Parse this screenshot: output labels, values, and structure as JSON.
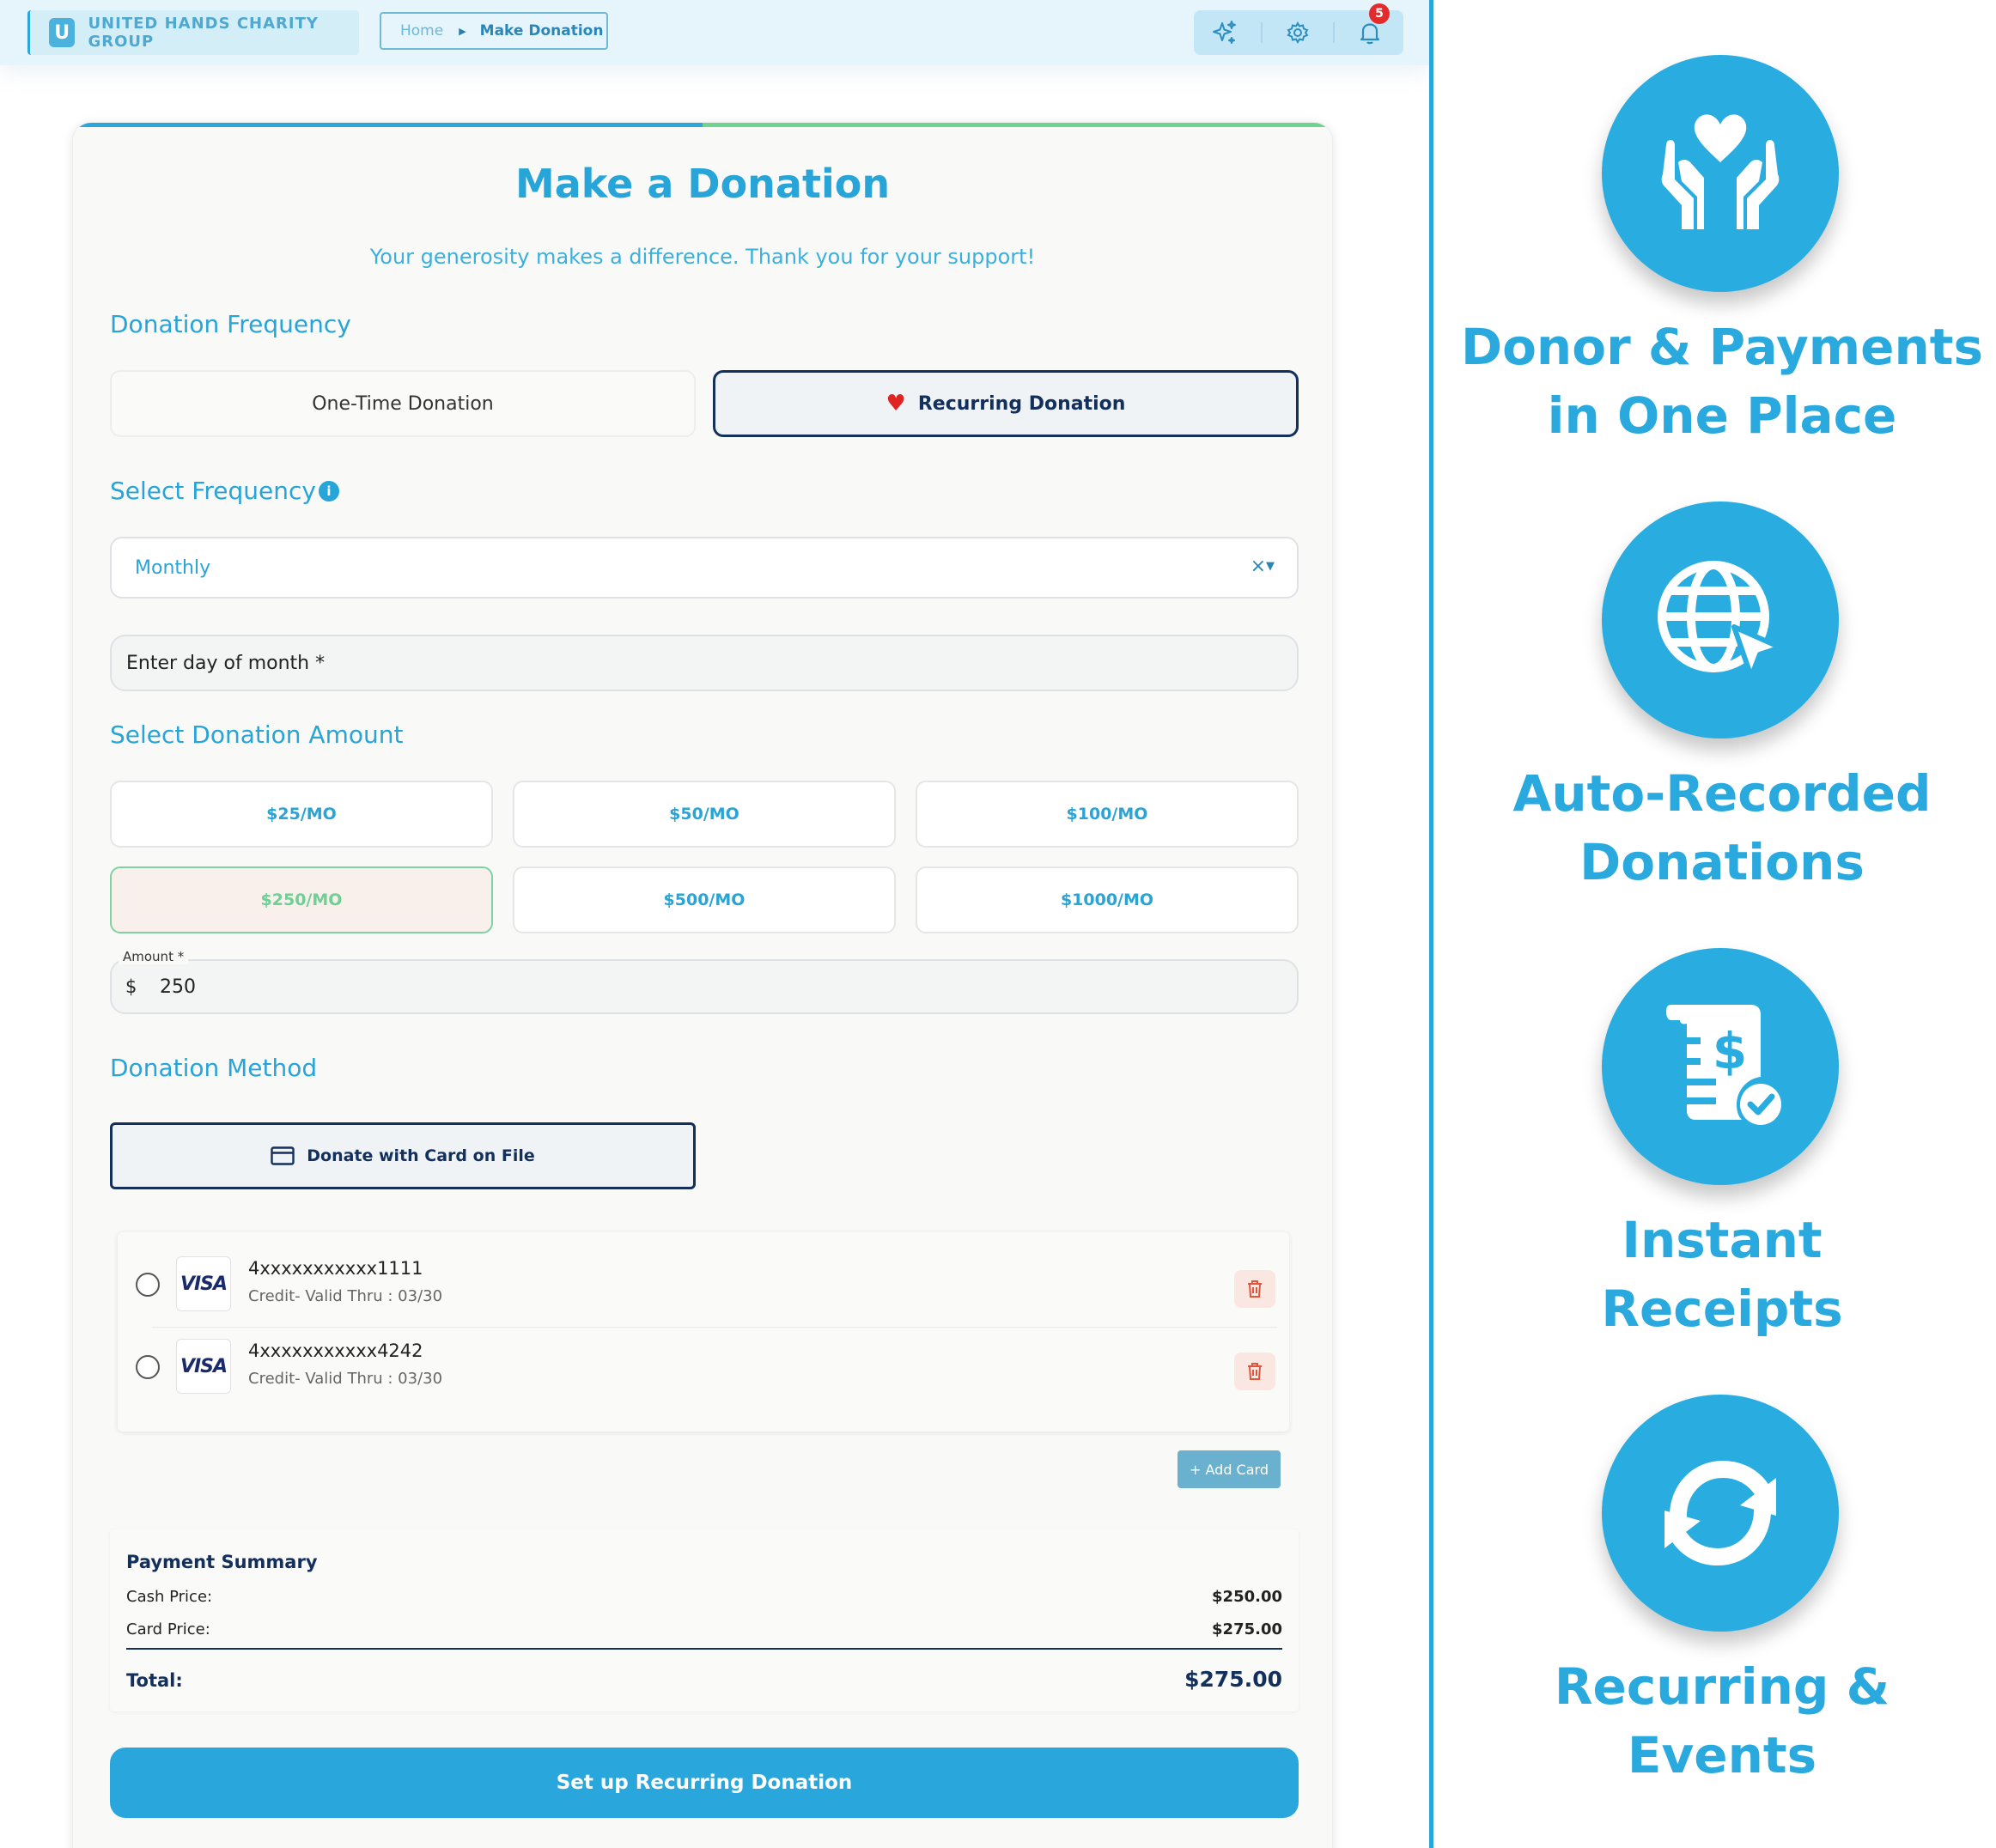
{
  "topbar": {
    "org_initial": "U",
    "org_name": "UNITED HANDS CHARITY GROUP",
    "breadcrumb": {
      "home": "Home",
      "current": "Make Donation"
    },
    "notification_count": "5"
  },
  "form": {
    "title": "Make a Donation",
    "subtitle": "Your generosity makes a difference. Thank you for your support!",
    "frequency_section": "Donation Frequency",
    "one_time_label": "One-Time Donation",
    "recurring_label": "Recurring Donation",
    "select_frequency_label": "Select Frequency",
    "frequency_value": "Monthly",
    "frequency_clear": "×",
    "day_placeholder": "Enter day of month *",
    "amount_section": "Select Donation Amount",
    "amount_options": [
      "$25/MO",
      "$50/MO",
      "$100/MO",
      "$250/MO",
      "$500/MO",
      "$1000/MO"
    ],
    "selected_amount_option": "$250/MO",
    "amount_label": "Amount *",
    "amount_currency": "$",
    "amount_value": "250",
    "method_section": "Donation Method",
    "card_on_file_label": "Donate with Card on File",
    "saved_cards": [
      {
        "brand": "VISA",
        "number": "4xxxxxxxxxxx1111",
        "meta": "Credit- Valid Thru : 03/30"
      },
      {
        "brand": "VISA",
        "number": "4xxxxxxxxxxx4242",
        "meta": "Credit- Valid Thru : 03/30"
      }
    ],
    "add_card_label": "+ Add Card",
    "summary": {
      "title": "Payment Summary",
      "cash_label": "Cash Price:",
      "cash_value": "$250.00",
      "card_label": "Card Price:",
      "card_value": "$275.00",
      "total_label": "Total:",
      "total_value": "$275.00"
    },
    "submit_label": "Set up Recurring Donation"
  },
  "features": [
    {
      "icon": "hands-heart-icon",
      "line1": "Donor & Payments",
      "line2": "in One Place"
    },
    {
      "icon": "globe-cursor-icon",
      "line1": "Auto-Recorded",
      "line2": "Donations"
    },
    {
      "icon": "receipt-check-icon",
      "line1": "Instant",
      "line2": "Receipts"
    },
    {
      "icon": "recurring-arrows-icon",
      "line1": "Recurring &",
      "line2": "Events"
    }
  ],
  "colors": {
    "brand": "#29a7dd",
    "navy": "#13305c",
    "selected_amount": "#6fcf95",
    "notification": "#e32b2b"
  }
}
